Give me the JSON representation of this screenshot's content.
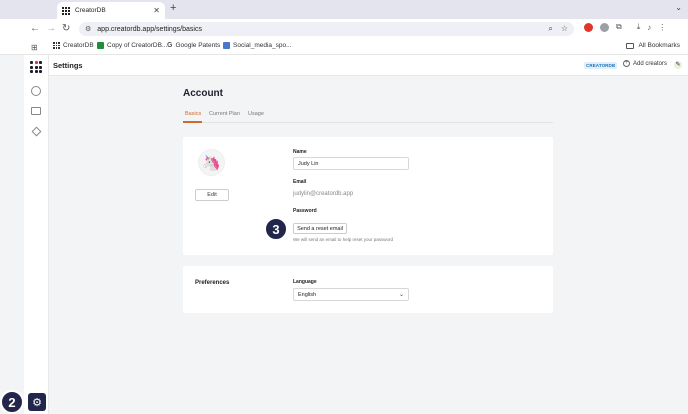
{
  "browser": {
    "tab_title": "CreatorDB",
    "new_tab": "+",
    "url": "app.creatordb.app/settings/basics",
    "bookmarks": [
      {
        "label": "CreatorDB"
      },
      {
        "label": "Copy of CreatorDB..."
      },
      {
        "label": "Google Patents"
      },
      {
        "label": "Social_media_spo..."
      }
    ],
    "all_bookmarks": "All Bookmarks"
  },
  "app": {
    "title": "Settings",
    "brand_chip": "CREATORDB",
    "add_creators": "Add creators"
  },
  "page": {
    "heading": "Account",
    "tabs": [
      {
        "label": "Basics",
        "active": true
      },
      {
        "label": "Current Plan",
        "active": false
      },
      {
        "label": "Usage",
        "active": false
      }
    ]
  },
  "profile": {
    "edit_label": "Edit",
    "name_label": "Name",
    "name_value": "Judy Lin",
    "email_label": "Email",
    "email_value": "judylin@creatordb.app",
    "password_label": "Password",
    "reset_button": "Send a reset email",
    "reset_helper": "We will send an email to help reset your password"
  },
  "preferences": {
    "title": "Preferences",
    "language_label": "Language",
    "language_value": "English"
  },
  "annotations": {
    "step_3": "3",
    "step_2": "2"
  },
  "colors": {
    "accent": "#d0692a",
    "badge": "#22264a"
  }
}
